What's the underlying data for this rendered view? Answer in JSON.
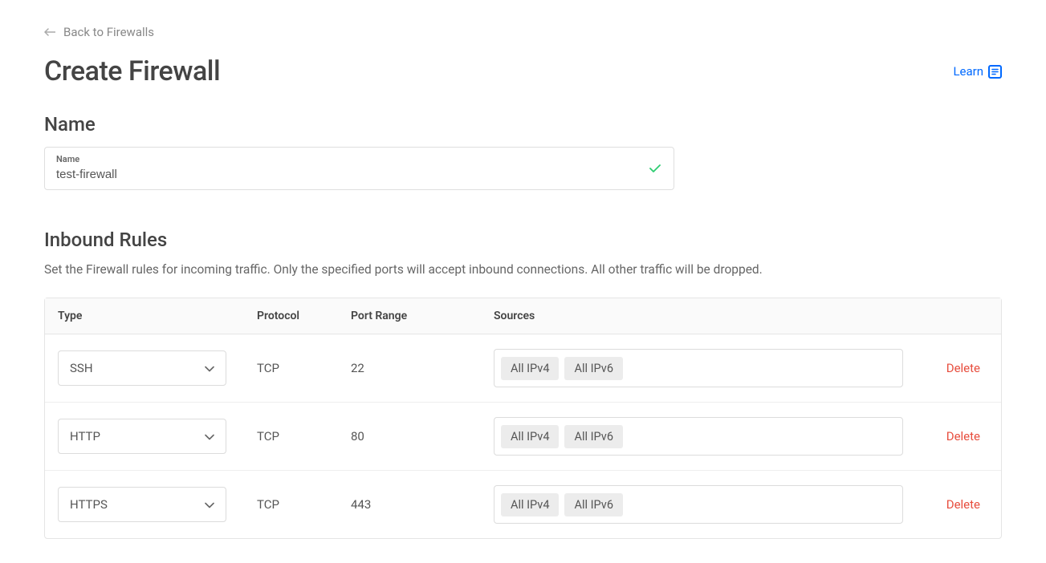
{
  "nav": {
    "back_label": "Back to Firewalls"
  },
  "header": {
    "title": "Create Firewall",
    "learn_label": "Learn"
  },
  "name_section": {
    "title": "Name",
    "field_label": "Name",
    "value": "test-firewall"
  },
  "inbound": {
    "title": "Inbound Rules",
    "description": "Set the Firewall rules for incoming traffic. Only the specified ports will accept inbound connections. All other traffic will be dropped.",
    "columns": {
      "type": "Type",
      "protocol": "Protocol",
      "port_range": "Port Range",
      "sources": "Sources"
    },
    "rules": [
      {
        "type": "SSH",
        "protocol": "TCP",
        "port_range": "22",
        "sources": [
          "All IPv4",
          "All IPv6"
        ],
        "action": "Delete"
      },
      {
        "type": "HTTP",
        "protocol": "TCP",
        "port_range": "80",
        "sources": [
          "All IPv4",
          "All IPv6"
        ],
        "action": "Delete"
      },
      {
        "type": "HTTPS",
        "protocol": "TCP",
        "port_range": "443",
        "sources": [
          "All IPv4",
          "All IPv6"
        ],
        "action": "Delete"
      }
    ]
  }
}
